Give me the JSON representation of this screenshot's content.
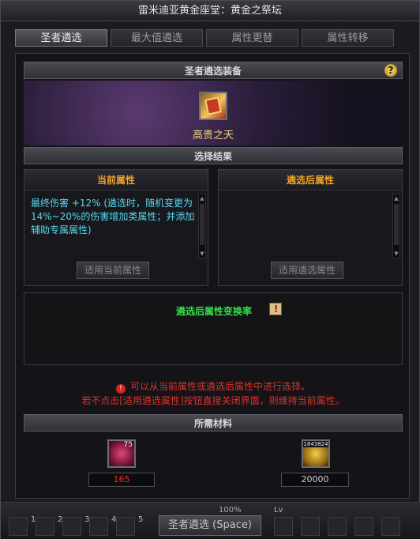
{
  "window": {
    "title": "雷米迪亚黄金座堂：黄金之祭坛"
  },
  "tabs": [
    {
      "label": "圣者遴选",
      "active": true
    },
    {
      "label": "最大值遴选",
      "active": false
    },
    {
      "label": "属性更替",
      "active": false
    },
    {
      "label": "属性转移",
      "active": false
    }
  ],
  "equipment": {
    "section_title": "圣者遴选装备",
    "help_label": "?",
    "item_name": "高贵之天",
    "item_icon": "book-icon"
  },
  "result": {
    "section_title": "选择结果",
    "current": {
      "header": "当前属性",
      "text": "最终伤害 +12% (遴选时，随机变更为14%~20%的伤害增加类属性；并添加辅助专属属性)",
      "button": "适用当前属性"
    },
    "after": {
      "header": "遴选后属性",
      "text": "",
      "button": "适用遴选属性"
    }
  },
  "rate": {
    "title": "遴选后属性变换率",
    "icon": "info-icon"
  },
  "notice": {
    "line1": "可以从当前属性或遴选后属性中进行选择。",
    "line2": "若不点击[适用遴选属性]按钮直接关闭界面，则维持当前属性。"
  },
  "materials": {
    "section_title": "所需材料",
    "items": [
      {
        "icon": "pink-gem-icon",
        "badge": "75",
        "count": "165",
        "count_color": "#e0322a"
      },
      {
        "icon": "gold-coin-icon",
        "badge": "1843824",
        "count": "20000",
        "count_color": "#d0d0d0"
      }
    ]
  },
  "footer": {
    "main_button": "圣者遴选 (Space)",
    "percent": "100%",
    "slot_numbers": [
      "1",
      "2",
      "3",
      "4",
      "5"
    ],
    "lv_label": "Lv"
  },
  "colors": {
    "accent_orange": "#f0a428",
    "text_cyan": "#55d8ee",
    "rate_green": "#34e046",
    "warning_red": "#e0322a",
    "item_gold": "#f4d870"
  }
}
